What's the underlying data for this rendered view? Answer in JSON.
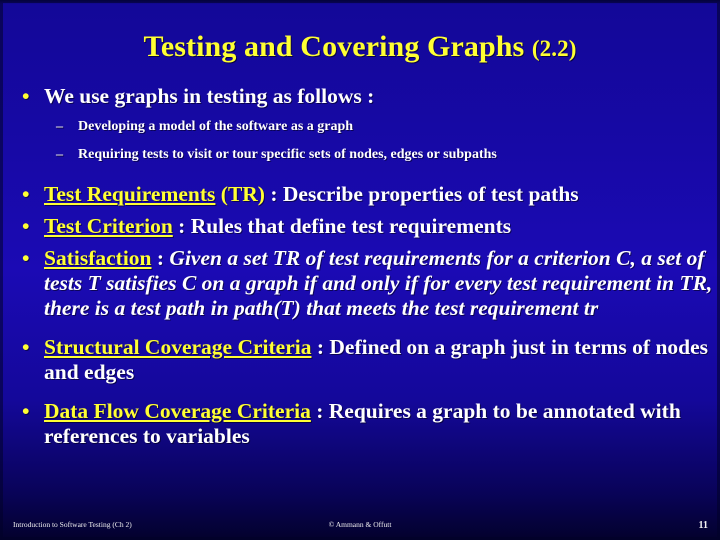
{
  "slide": {
    "title_main": "Testing and Covering Graphs ",
    "title_sub": "(2.2)",
    "bullet_marker": "•",
    "dash_marker": "–"
  },
  "content": {
    "b1": {
      "text": "We use graphs in testing as follows :"
    },
    "s1": {
      "text": "Developing a model of the software as a graph"
    },
    "s2": {
      "text": "Requiring tests to visit or tour specific sets of nodes, edges or subpaths"
    },
    "b2": {
      "term": "Test Requirements",
      "term_extra": " (TR)",
      "rest": " : Describe properties of test paths"
    },
    "b3": {
      "term": "Test Criterion",
      "rest": " : Rules that define test requirements"
    },
    "b4": {
      "term": "Satisfaction",
      "rest_plain": " : ",
      "rest_italic": "Given a set TR of test requirements for a criterion C, a set of tests T satisfies C on a graph if and only if for every test requirement in TR, there is a test path in path(T) that meets the test requirement tr"
    },
    "b5": {
      "term": "Structural Coverage Criteria",
      "rest": " : Defined on a graph just in terms of nodes and edges"
    },
    "b6": {
      "term": "Data Flow Coverage Criteria",
      "rest": " : Requires a graph to be annotated with references to variables"
    }
  },
  "footer": {
    "left": "Introduction to Software Testing (Ch 2)",
    "center": "© Ammann & Offutt",
    "page": "11"
  },
  "colors": {
    "accent_yellow": "#ffff33",
    "text_white": "#ffffff",
    "background_blue": "#1b0ab4",
    "background_dark": "#03012c"
  }
}
